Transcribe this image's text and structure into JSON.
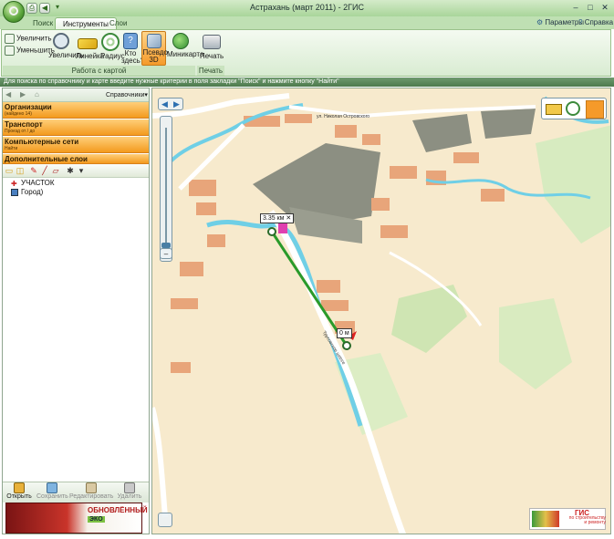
{
  "window": {
    "title": "Астрахань (март 2011) - 2ГИС",
    "min_glyph": "–",
    "max_glyph": "□",
    "close_glyph": "✕"
  },
  "quick_access": {
    "print_glyph": "⎙",
    "back_glyph": "◀",
    "forward_glyph": "▶",
    "dropdown_glyph": "▾"
  },
  "tabs": [
    {
      "label": "Поиск"
    },
    {
      "label": "Инструменты"
    },
    {
      "label": "Слои"
    }
  ],
  "header_links": {
    "params": "Параметры",
    "help": "Справка"
  },
  "ribbon": {
    "zoom_in": "Увеличить",
    "zoom_out": "Уменьшить",
    "zoom": "Увеличить",
    "ruler": "Линейка",
    "radius": "Радиус",
    "who_here": "Кто здесь?",
    "pseudo3d": "Псевдо 3D",
    "minimap": "Миникарта",
    "print": "Печать",
    "group_map": "Работа с картой",
    "group_print": "Печать"
  },
  "info_text": "Для поиска по справочнику и карте введите нужные критерии в поля закладки \"Поиск\" и нажмите кнопку \"Найти\"",
  "left_panel": {
    "nav_back": "◀",
    "nav_forward": "▶",
    "directories_label": "Справочники",
    "categories": [
      {
        "title": "Организации",
        "sub": "(найдено 14)"
      },
      {
        "title": "Транспорт",
        "sub": "Проезд от / до"
      },
      {
        "title": "Компьютерные сети",
        "sub": "Найти"
      },
      {
        "title": "Дополнительные слои",
        "sub": ""
      }
    ],
    "layers": [
      {
        "label": "УЧАСТОК"
      },
      {
        "label": "Город)"
      }
    ],
    "bottom_buttons": {
      "open": "Открыть",
      "save": "Сохранить",
      "edit": "Редактировать",
      "delete": "Удалить"
    },
    "ad": {
      "line1": "ОБНОВЛЁННЫЙ",
      "line2": "ЭКО"
    }
  },
  "map": {
    "distance_start": "3.35 км",
    "distance_end": "0 м",
    "street_label": "ул. Николая Островского",
    "road_label": "Трусовское шоссе",
    "logo_title": "ГИС",
    "logo_sub": "по строительству и ремонту"
  },
  "colors": {
    "ribbon_green": "#a9d59a",
    "category_orange": "#f39a1e",
    "map_bg": "#f7eacd",
    "water": "#6fcfe6",
    "green_area": "#cfe5b3",
    "industrial": "#8c8f82",
    "measure_line": "#2a9a2a"
  }
}
